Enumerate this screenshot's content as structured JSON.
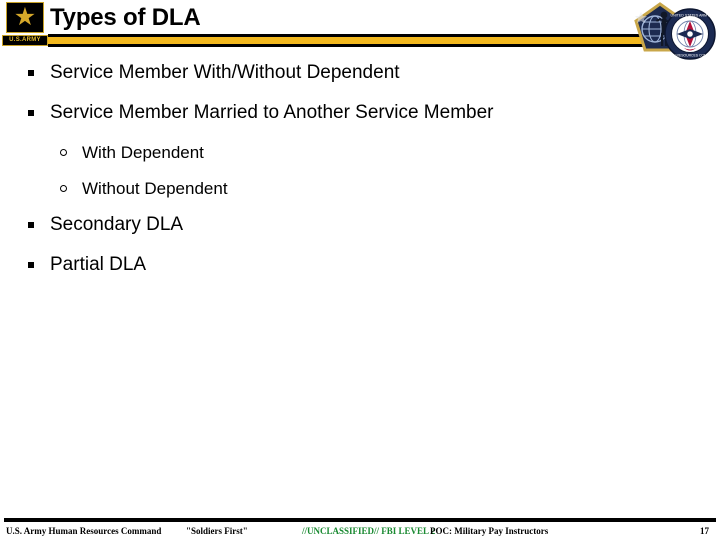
{
  "slide": {
    "title": "Types of DLA",
    "page_number": "17"
  },
  "logos": {
    "army_star_label": "U.S.ARMY",
    "army_star_icon": "army-star-icon",
    "hrc_pentagon_icon": "hrc-pentagon-emblem-icon",
    "seal_icon": "human-resources-command-seal-icon"
  },
  "bullets": [
    {
      "level": 1,
      "marker": "square",
      "text": "Service Member With/Without Dependent"
    },
    {
      "level": 1,
      "marker": "square",
      "text": "Service Member Married to Another Service Member"
    },
    {
      "level": 2,
      "marker": "circle",
      "text": "With Dependent"
    },
    {
      "level": 2,
      "marker": "circle",
      "text": "Without Dependent"
    },
    {
      "level": 1,
      "marker": "square",
      "text": "Secondary DLA"
    },
    {
      "level": 1,
      "marker": "square",
      "text": "Partial DLA"
    }
  ],
  "footer": {
    "organization": "U.S. Army Human Resources Command",
    "motto": "\"Soldiers First\"",
    "classification": "//UNCLASSIFIED// FBI LEVEL 2",
    "poc": "POC: Military Pay Instructors",
    "page_number": "17"
  },
  "colors": {
    "gold_bar": "#f2b81e",
    "classification_green": "#1a8a32",
    "text_black": "#000000",
    "background": "#ffffff"
  }
}
